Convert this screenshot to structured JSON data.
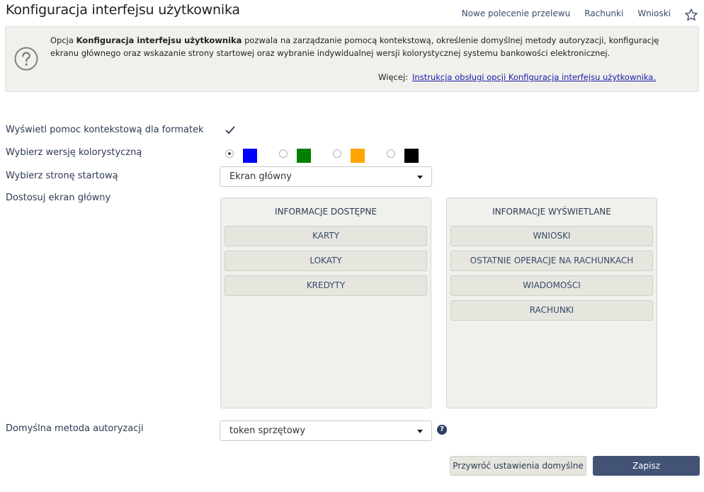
{
  "header": {
    "title": "Konfiguracja interfejsu użytkownika",
    "links": [
      "Nowe polecenie przelewu",
      "Rachunki",
      "Wnioski"
    ]
  },
  "info": {
    "prefix": "Opcja ",
    "bold": "Konfiguracja interfejsu użytkownika",
    "text": " pozwala na zarządzanie pomocą kontekstową, określenie domyślnej metody autoryzacji, konfigurację ekranu głównego oraz wskazanie strony startowej oraz wybranie indywidualnej wersji kolorystycznej systemu bankowości elektronicznej.",
    "more_label": "Więcej:",
    "more_link": "Instrukcja obsługi opcji Konfiguracja interfejsu użytkownika."
  },
  "form": {
    "context_help_label": "Wyświetl pomoc kontekstową dla formatek",
    "context_help_checked": true,
    "color_label": "Wybierz wersję kolorystyczną",
    "colors": [
      "#0000ff",
      "#008000",
      "#ffa500",
      "#000000"
    ],
    "selected_color_index": 0,
    "start_page_label": "Wybierz stronę startową",
    "start_page_value": "Ekran główny",
    "customize_label": "Dostosuj ekran główny",
    "auth_label": "Domyślna metoda autoryzacji",
    "auth_value": "token sprzętowy",
    "help_glyph": "?"
  },
  "panels": {
    "available": {
      "title": "INFORMACJE DOSTĘPNE",
      "items": [
        "KARTY",
        "LOKATY",
        "KREDYTY"
      ]
    },
    "displayed": {
      "title": "INFORMACJE WYŚWIETLANE",
      "items": [
        "WNIOSKI",
        "OSTATNIE OPERACJE NA RACHUNKACH",
        "WIADOMOŚCI",
        "RACHUNKI"
      ]
    }
  },
  "buttons": {
    "reset": "Przywróć ustawienia domyślne",
    "save": "Zapisz"
  },
  "colors": {
    "accent": "#425376",
    "panel_bg": "#f0f0ed",
    "link": "#1a1aa6"
  },
  "icons": [
    "star-icon",
    "help-circle-icon",
    "checkmark-icon",
    "question-icon",
    "caret-down-icon"
  ]
}
